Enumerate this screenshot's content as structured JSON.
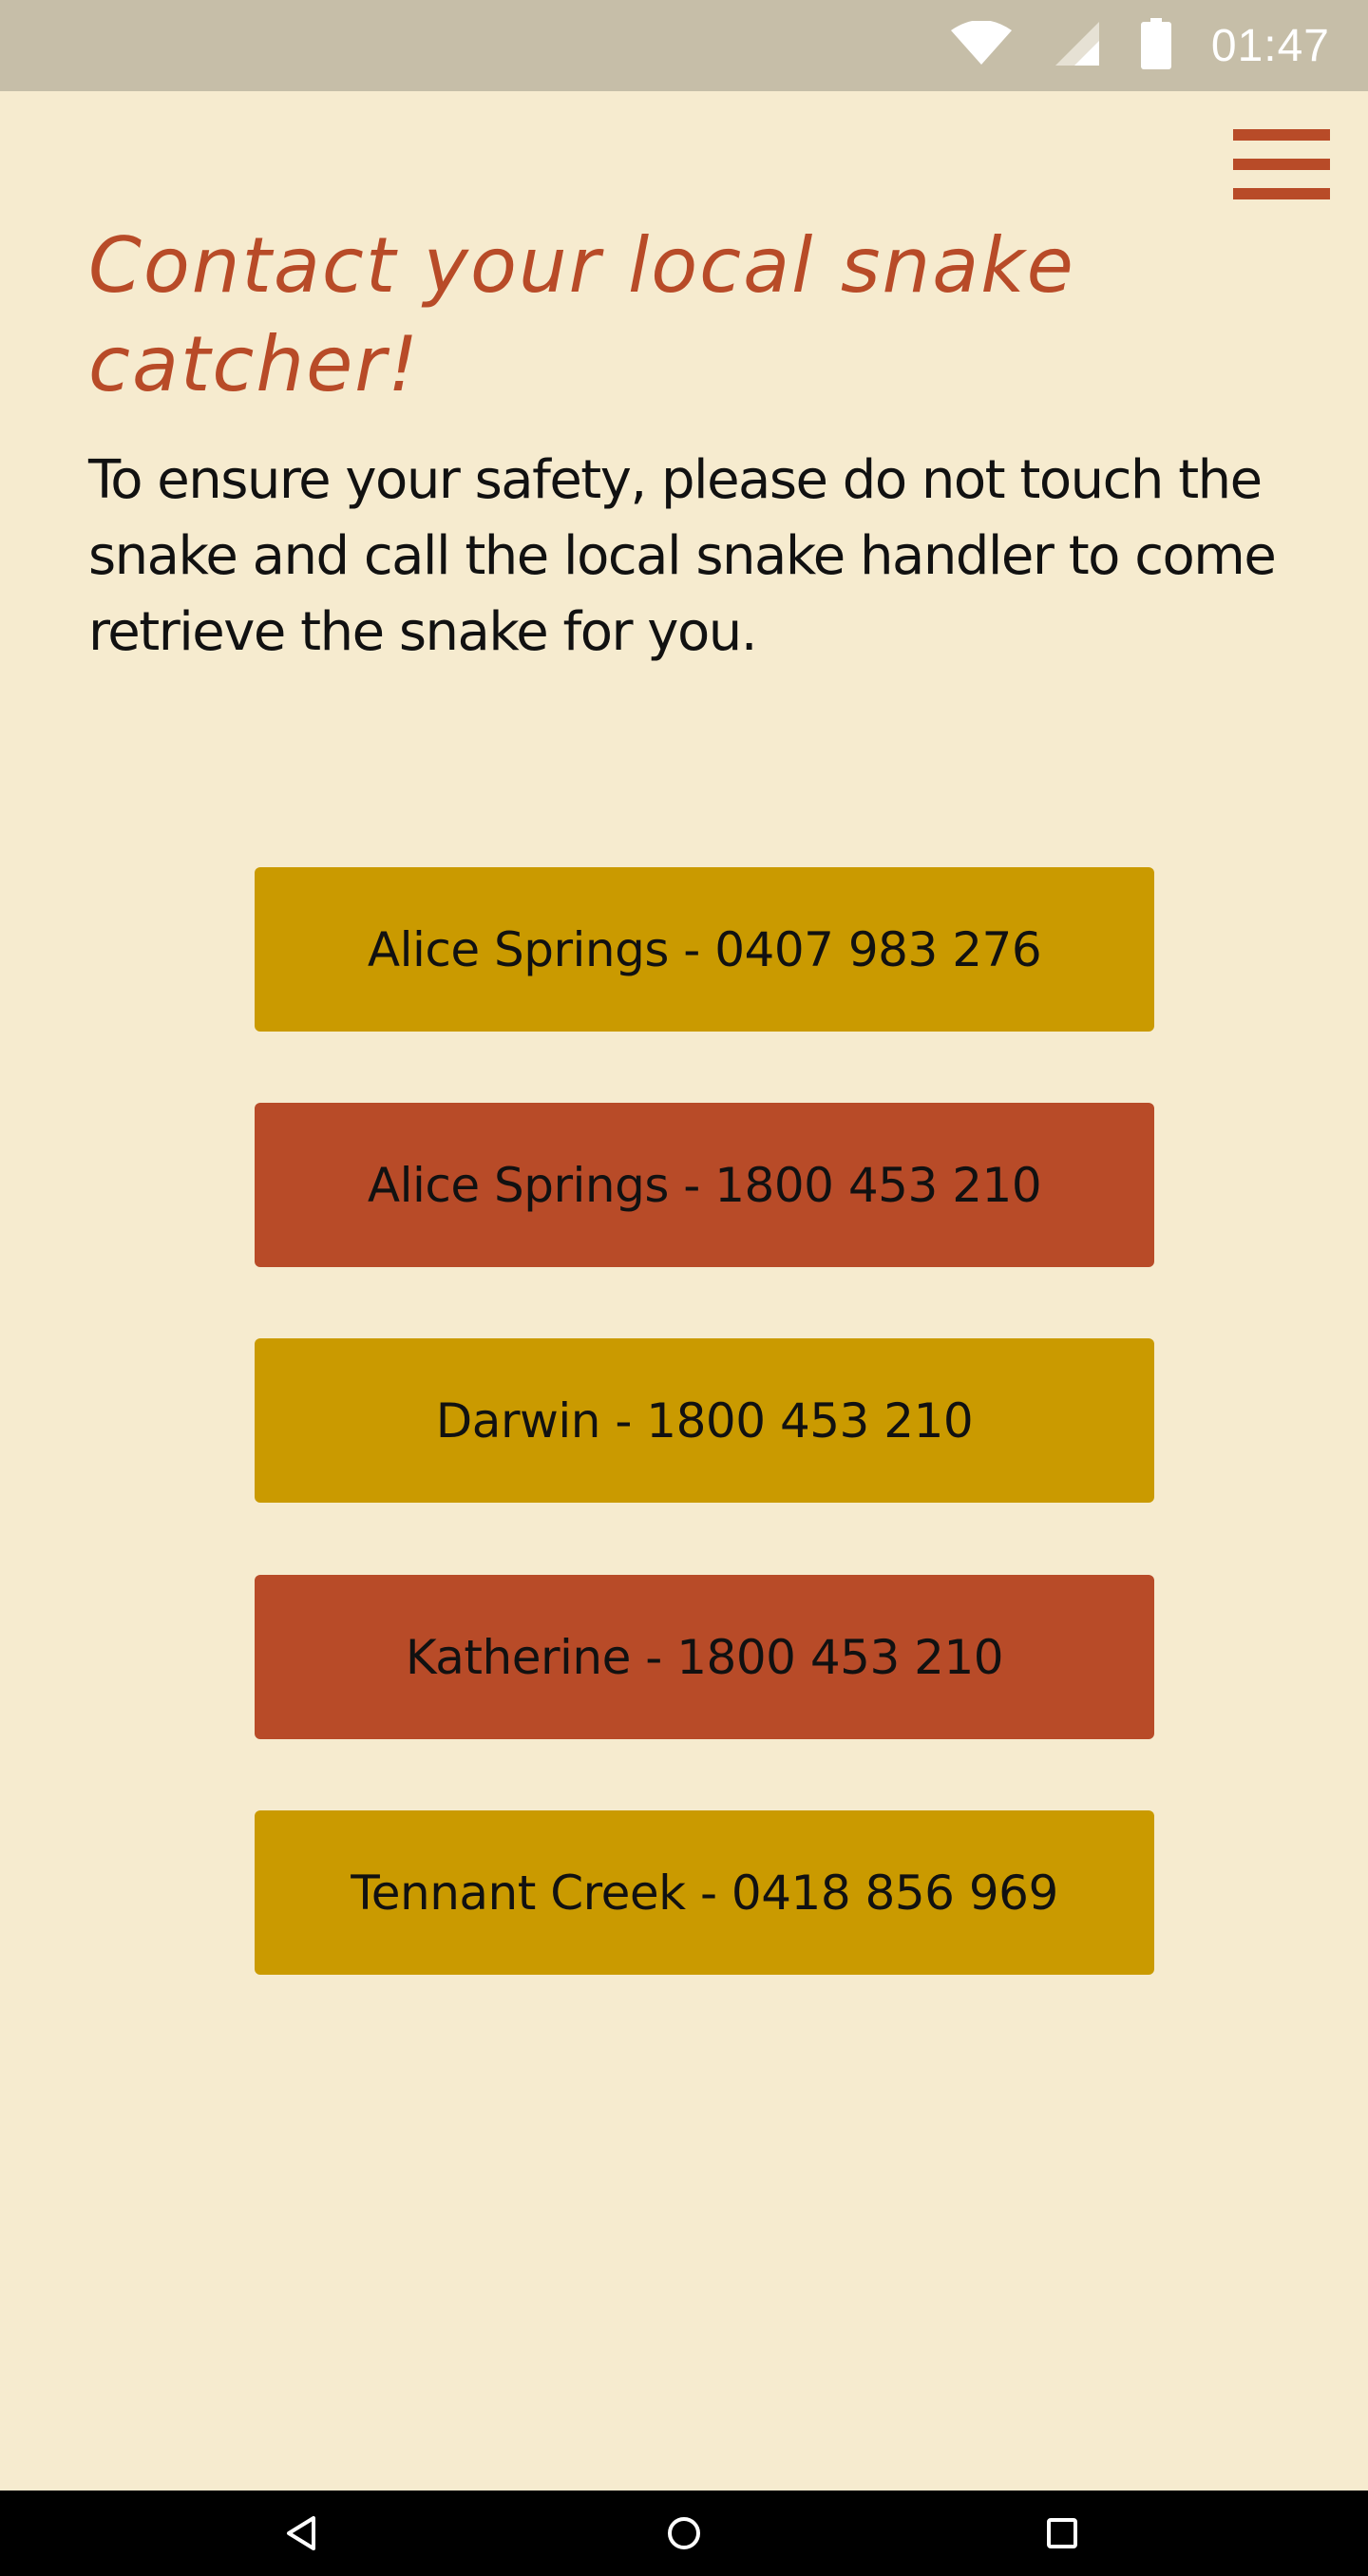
{
  "status_bar": {
    "time": "01:47",
    "icons": [
      "wifi-icon",
      "cell-signal-icon",
      "battery-icon"
    ]
  },
  "header": {
    "menu_icon": "hamburger-menu-icon"
  },
  "main": {
    "title": "Contact your local snake catcher!",
    "intro": "To ensure your safety, please do not touch the snake and call the local snake handler to come retrieve the snake for you.",
    "contacts": [
      {
        "label": "Alice Springs - 0407 983 276",
        "color": "#ca9a00"
      },
      {
        "label": "Alice Springs - 1800 453 210",
        "color": "#b84b28"
      },
      {
        "label": "Darwin - 1800 453 210",
        "color": "#ca9a00"
      },
      {
        "label": "Katherine - 1800 453 210",
        "color": "#b84b28"
      },
      {
        "label": "Tennant Creek - 0418 856 969",
        "color": "#ca9a00"
      }
    ]
  },
  "nav_bar": {
    "buttons": [
      "back-icon",
      "home-icon",
      "recents-icon"
    ]
  },
  "colors": {
    "background": "#f6ebcf",
    "accent": "#b84b28",
    "gold": "#ca9a00",
    "status_bar": "#c6bea8"
  }
}
